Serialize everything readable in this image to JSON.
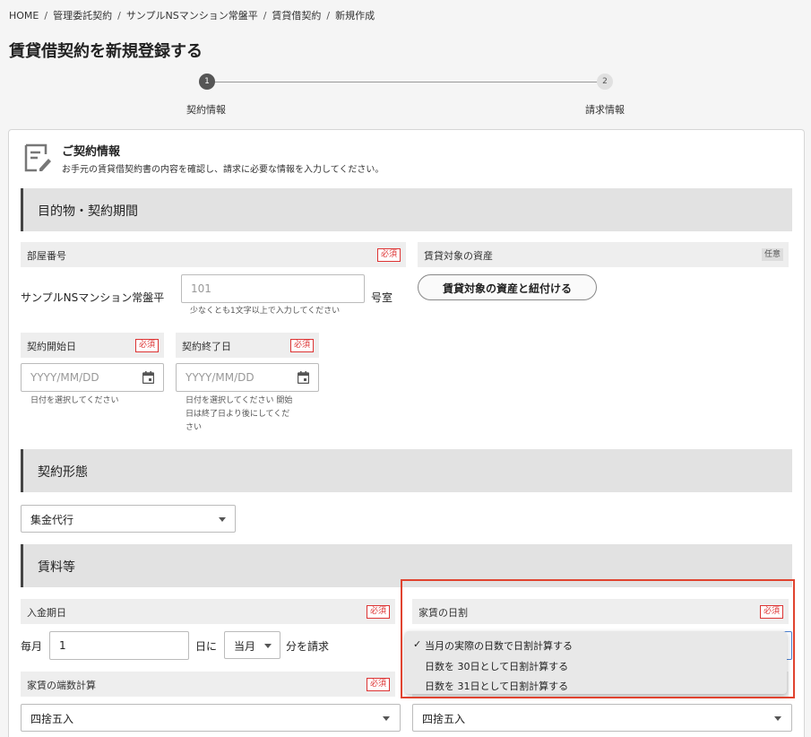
{
  "breadcrumb": [
    "HOME",
    "管理委託契約",
    "サンプルNSマンション常盤平",
    "賃貸借契約",
    "新規作成"
  ],
  "page_title": "賃貸借契約を新規登録する",
  "steps": [
    {
      "number": "1",
      "label": "契約情報"
    },
    {
      "number": "2",
      "label": "請求情報"
    }
  ],
  "card": {
    "title": "ご契約情報",
    "description": "お手元の賃貸借契約書の内容を確認し、請求に必要な情報を入力してください。"
  },
  "badges": {
    "required": "必須",
    "optional": "任意"
  },
  "section1": {
    "title": "目的物・契約期間",
    "room_label": "部屋番号",
    "building_name": "サンプルNSマンション常盤平",
    "room_placeholder": "101",
    "room_hint": "少なくとも1文字以上で入力してください",
    "room_suffix": "号室",
    "asset_label": "賃貸対象の資産",
    "asset_button": "賃貸対象の資産と紐付ける",
    "start_label": "契約開始日",
    "end_label": "契約終了日",
    "date_placeholder": "YYYY/MM/DD",
    "start_hint": "日付を選択してください",
    "end_hint_lines": [
      "日付を選択してください 開始",
      "日は終了日より後にしてくだ",
      "さい"
    ]
  },
  "section2": {
    "title": "契約形態",
    "contract_type": "集金代行"
  },
  "section3": {
    "title": "賃料等",
    "payment_label": "入金期日",
    "payment_prefix": "毎月",
    "payment_day": "1",
    "payment_day_suffix": "日に",
    "payment_month": "当月",
    "payment_suffix": "分を請求",
    "prorate_label": "家賃の日割",
    "prorate_options": [
      "当月の実際の日数で日割計算する",
      "日数を 30日として日割計算する",
      "日数を 31日として日割計算する"
    ],
    "prorate_selected_index": 0,
    "rounding_label": "家賃の端数計算",
    "rounding_value": "四捨五入",
    "rounding_value_right": "四捨五入"
  },
  "colors": {
    "highlight": "#e0432f",
    "required": "#dd3333"
  }
}
